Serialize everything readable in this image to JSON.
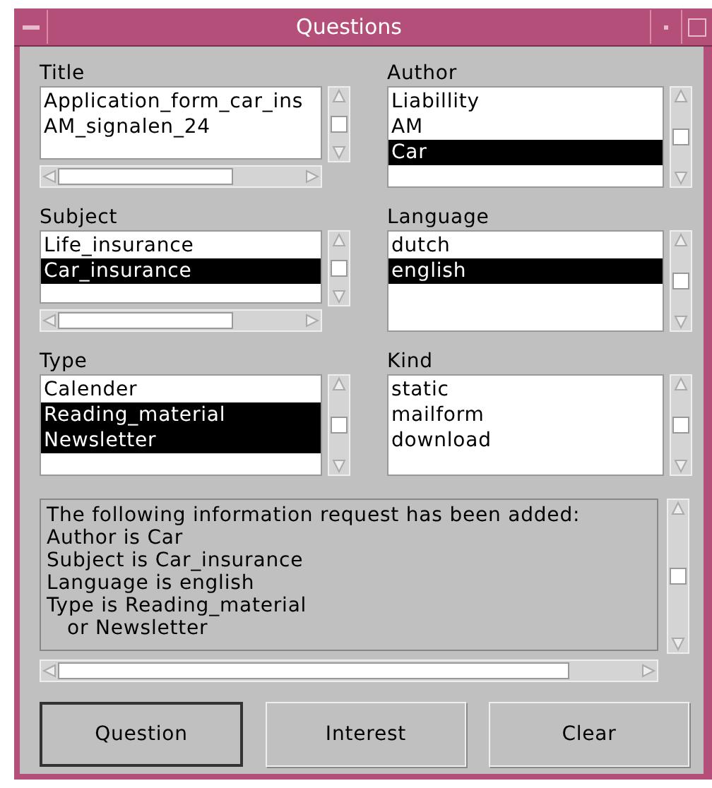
{
  "window": {
    "title": "Questions"
  },
  "lists": [
    {
      "label": "Title",
      "hscroll": true,
      "items": [
        {
          "label": "Application_form_car_ins",
          "selected": false
        },
        {
          "label": "AM_signalen_24",
          "selected": false
        }
      ]
    },
    {
      "label": "Author",
      "hscroll": false,
      "items": [
        {
          "label": "Liabillity",
          "selected": false
        },
        {
          "label": "AM",
          "selected": false
        },
        {
          "label": "Car",
          "selected": true
        }
      ]
    },
    {
      "label": "Subject",
      "hscroll": true,
      "items": [
        {
          "label": "Life_insurance",
          "selected": false
        },
        {
          "label": "Car_insurance",
          "selected": true
        }
      ]
    },
    {
      "label": "Language",
      "hscroll": false,
      "items": [
        {
          "label": "dutch",
          "selected": false
        },
        {
          "label": "english",
          "selected": true
        }
      ]
    },
    {
      "label": "Type",
      "hscroll": false,
      "items": [
        {
          "label": "Calender",
          "selected": false
        },
        {
          "label": "Reading_material",
          "selected": true
        },
        {
          "label": "Newsletter",
          "selected": true
        }
      ]
    },
    {
      "label": "Kind",
      "hscroll": false,
      "items": [
        {
          "label": "static",
          "selected": false
        },
        {
          "label": "mailform",
          "selected": false
        },
        {
          "label": "download",
          "selected": false
        }
      ]
    }
  ],
  "message": {
    "lines": [
      "The following information request has been added:",
      "Author is Car",
      "Subject is Car_insurance",
      "Language is english",
      "Type is Reading_material",
      "   or Newsletter"
    ]
  },
  "buttons": [
    {
      "label": "Question",
      "default": true
    },
    {
      "label": "Interest",
      "default": false
    },
    {
      "label": "Clear",
      "default": false
    }
  ]
}
